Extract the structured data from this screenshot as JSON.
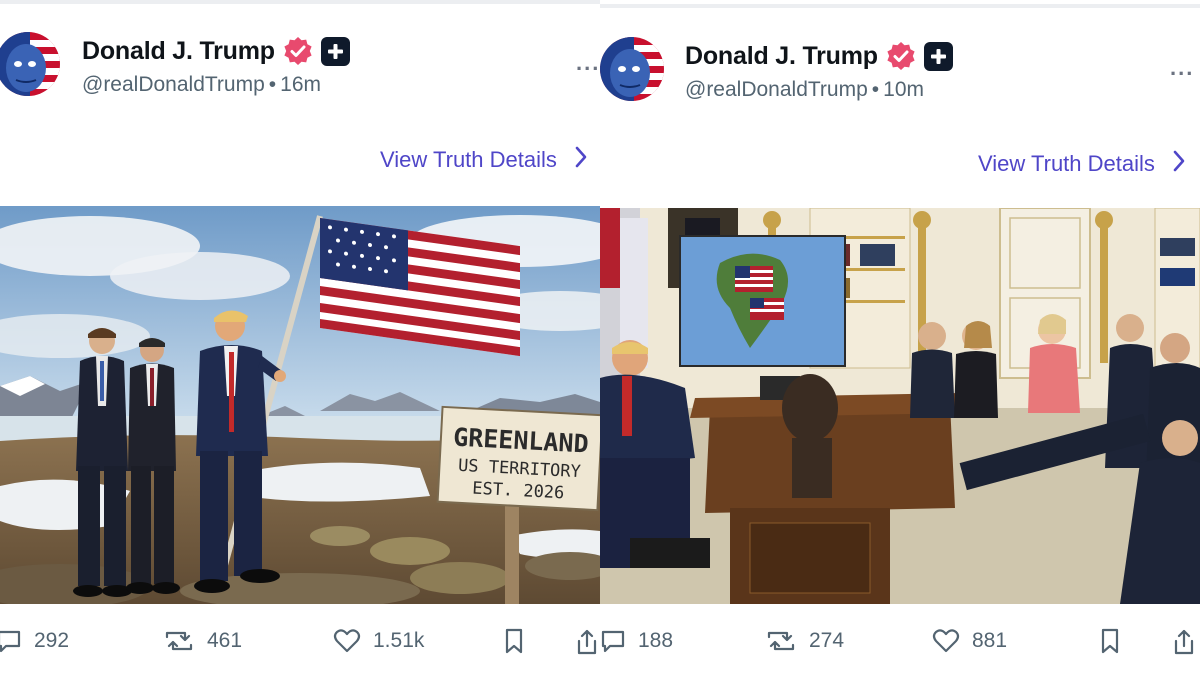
{
  "colors": {
    "accent": "#4f46c8",
    "verified": "#e84a6e",
    "plus_badge": "#0f1a2b",
    "meta": "#536471"
  },
  "posts": [
    {
      "author": {
        "name": "Donald J. Trump",
        "handle": "@realDonaldTrump",
        "time": "16m"
      },
      "separator": "•",
      "more_label": "...",
      "details_label": "View Truth Details",
      "image": {
        "sign_line1": "GREENLAND",
        "sign_line2": "US TERRITORY",
        "sign_line3": "EST. 2026"
      },
      "stats": {
        "replies": "292",
        "retruths": "461",
        "likes": "1.51k"
      }
    },
    {
      "author": {
        "name": "Donald J. Trump",
        "handle": "@realDonaldTrump",
        "time": "10m"
      },
      "separator": "•",
      "more_label": "...",
      "details_label": "View Truth Details",
      "stats": {
        "replies": "188",
        "retruths": "274",
        "likes": "881"
      }
    }
  ],
  "icons": [
    "verified-icon",
    "plus-icon",
    "more-icon",
    "chevron-right-icon",
    "reply-icon",
    "retruth-icon",
    "like-icon",
    "bookmark-icon",
    "share-icon"
  ]
}
